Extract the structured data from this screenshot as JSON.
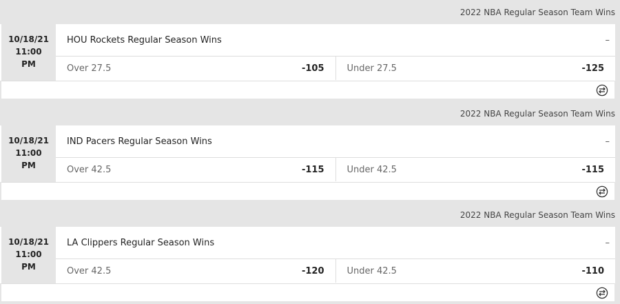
{
  "games": [
    {
      "league": "2022 NBA Regular Season Team Wins",
      "date": "10/18/21",
      "time": "11:00",
      "ampm": "PM",
      "market": "HOU Rockets Regular Season Wins",
      "dash": "–",
      "over_label": "Over 27.5",
      "over_price": "-105",
      "under_label": "Under 27.5",
      "under_price": "-125",
      "footer_icon": "compare-icon"
    },
    {
      "league": "2022 NBA Regular Season Team Wins",
      "date": "10/18/21",
      "time": "11:00",
      "ampm": "PM",
      "market": "IND Pacers Regular Season Wins",
      "dash": "–",
      "over_label": "Over 42.5",
      "over_price": "-115",
      "under_label": "Under 42.5",
      "under_price": "-115",
      "footer_icon": "compare-icon"
    },
    {
      "league": "2022 NBA Regular Season Team Wins",
      "date": "10/18/21",
      "time": "11:00",
      "ampm": "PM",
      "market": "LA Clippers Regular Season Wins",
      "dash": "–",
      "over_label": "Over 42.5",
      "over_price": "-120",
      "under_label": "Under 42.5",
      "under_price": "-110",
      "footer_icon": "compare-icon"
    }
  ]
}
